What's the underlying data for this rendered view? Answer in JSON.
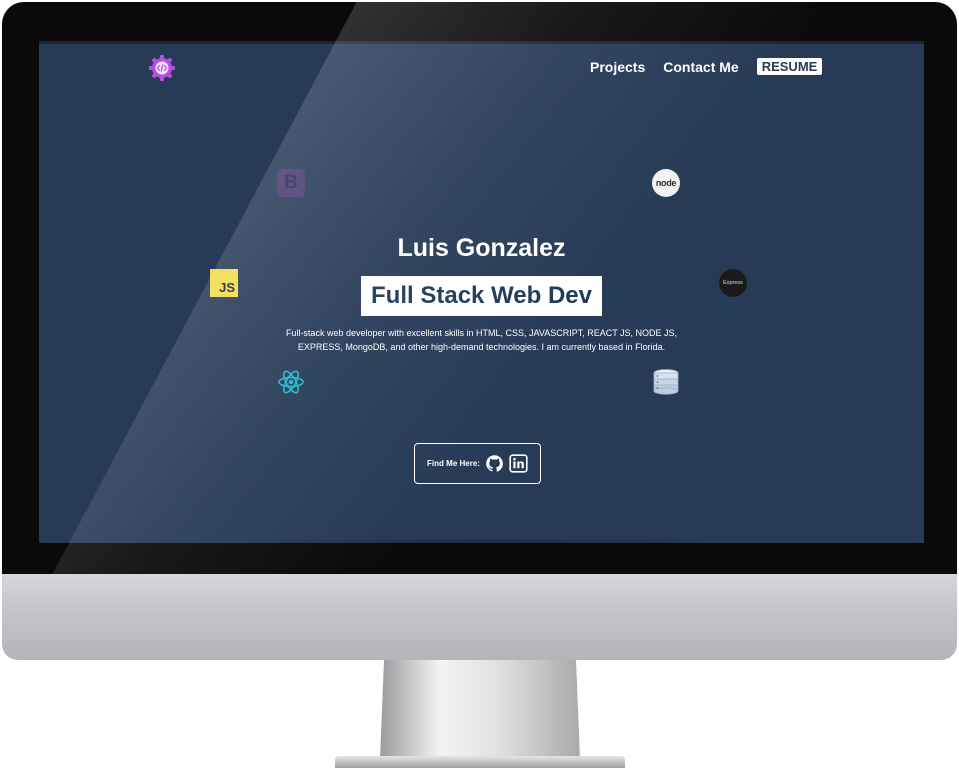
{
  "site": {
    "logo_icon": "code-gear-logo-icon",
    "logo_color": "#b44fe0"
  },
  "nav": {
    "projects": "Projects",
    "contact": "Contact Me",
    "resume": "RESUME"
  },
  "tech_icons": {
    "bootstrap_letter": "B",
    "js_label": "JS",
    "node_label": "node",
    "express_label": "Express"
  },
  "hero": {
    "name": "Luis Gonzalez",
    "role": "Full Stack Web Dev",
    "description": "Full-stack web developer with excellent skills in HTML, CSS, JAVASCRIPT, REACT JS, NODE JS, EXPRESS, MongoDB, and other high-demand technologies. I am currently based in Florida."
  },
  "find_me": {
    "label": "Find Me Here:",
    "icons": [
      "github-icon",
      "linkedin-icon"
    ]
  },
  "colors": {
    "screen_bg": "#273b57",
    "accent_text": "#1f3a56",
    "bootstrap": "#563d7c",
    "javascript": "#f0db4f",
    "react": "#22b8cf"
  }
}
